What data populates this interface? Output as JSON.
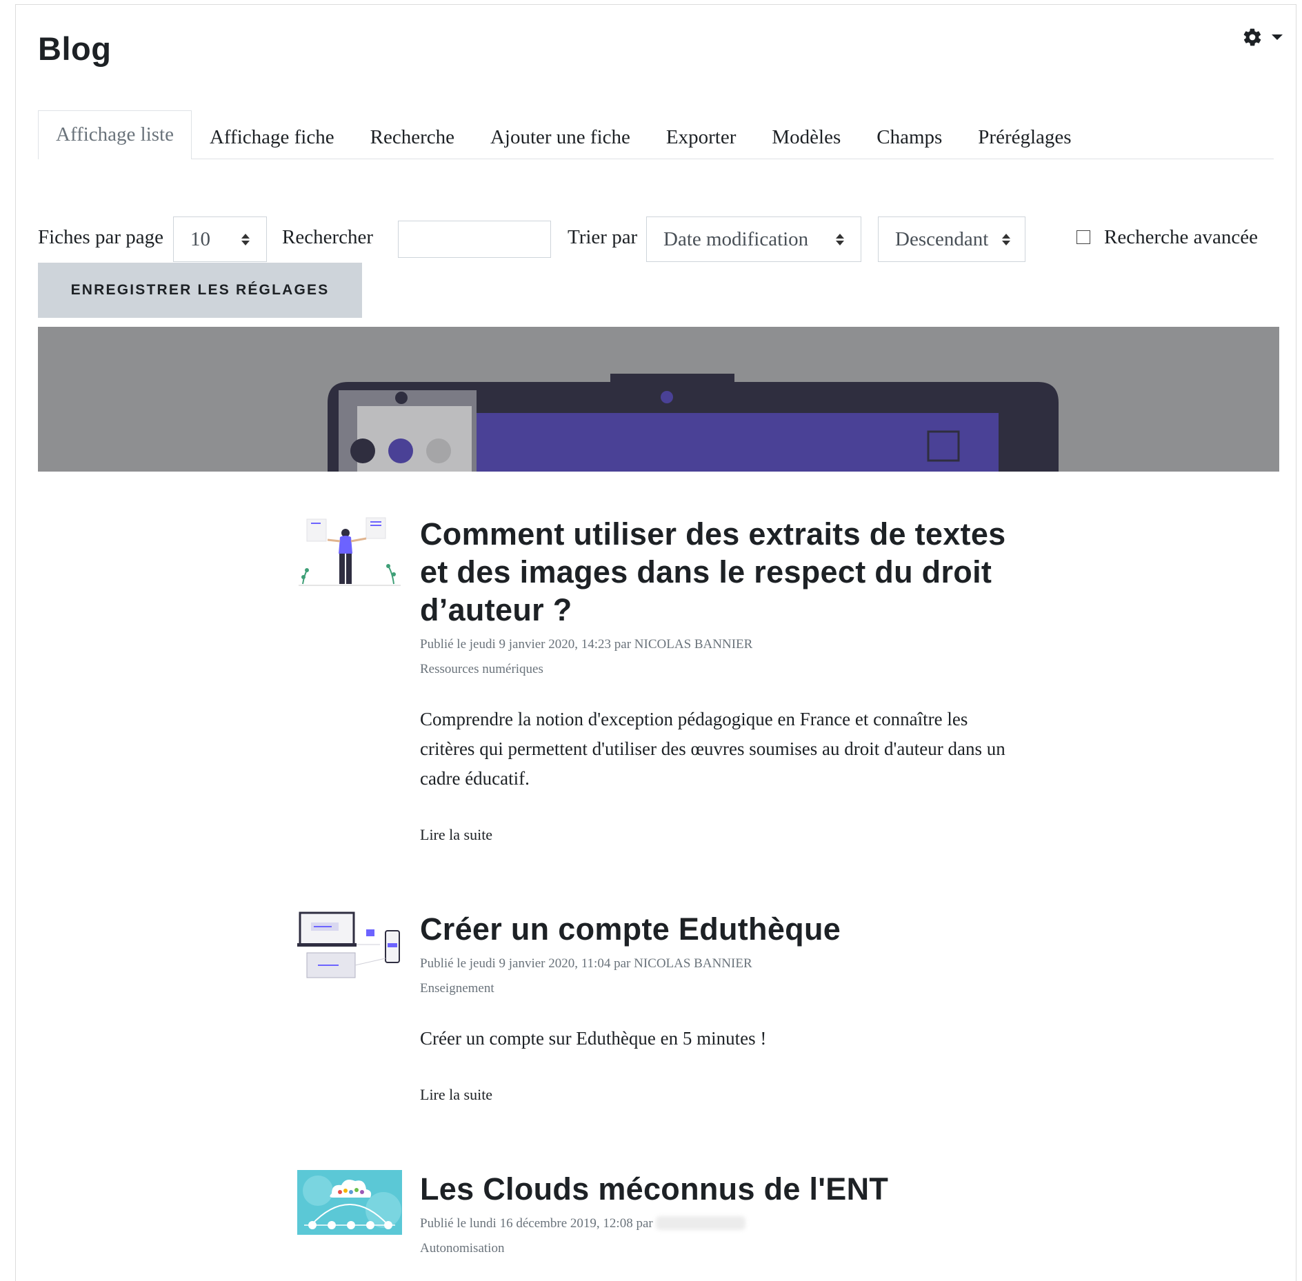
{
  "header": {
    "title": "Blog",
    "settings_icon": "gear-icon",
    "dropdown_icon": "caret-down-icon"
  },
  "tabs": [
    {
      "label": "Affichage liste",
      "active": true
    },
    {
      "label": "Affichage fiche",
      "active": false
    },
    {
      "label": "Recherche",
      "active": false
    },
    {
      "label": "Ajouter une fiche",
      "active": false
    },
    {
      "label": "Exporter",
      "active": false
    },
    {
      "label": "Modèles",
      "active": false
    },
    {
      "label": "Champs",
      "active": false
    },
    {
      "label": "Préréglages",
      "active": false
    }
  ],
  "controls": {
    "per_page_label": "Fiches par page",
    "per_page_value": "10",
    "search_label": "Rechercher",
    "search_value": "",
    "sort_label": "Trier par",
    "sort_value": "Date modification",
    "order_value": "Descendant",
    "advanced_search_label": "Recherche avancée",
    "advanced_search_checked": false,
    "save_button": "ENREGISTRER LES RÉGLAGES"
  },
  "posts": [
    {
      "title": "Comment utiliser des extraits de textes et des images dans le respect du droit d’auteur ?",
      "meta": "Publié le jeudi 9 janvier 2020, 14:23 par NICOLAS BANNIER",
      "category": "Ressources numériques",
      "excerpt": "Comprendre la notion d'exception pédagogique en France et connaître les critères qui permettent d'utiliser des œuvres soumises au droit d'auteur dans un cadre éducatif.",
      "read_more": "Lire la suite",
      "thumbnail": "person-holding-documents-illustration"
    },
    {
      "title": "Créer un compte Eduthèque",
      "meta": "Publié le jeudi 9 janvier 2020, 11:04 par NICOLAS BANNIER",
      "category": "Enseignement",
      "excerpt": "Créer un compte sur Eduthèque en 5 minutes !",
      "read_more": "Lire la suite",
      "thumbnail": "laptop-phone-account-illustration"
    },
    {
      "title": "Les Clouds méconnus de l'ENT",
      "meta": "Publié le lundi 16 décembre 2019, 12:08 par",
      "category": "Autonomisation",
      "thumbnail": "cloud-gears-illustration"
    }
  ],
  "colors": {
    "text": "#1d2125",
    "muted": "#6a737b",
    "accent_purple": "#4a4196",
    "save_button_bg": "#ced4da",
    "banner_bg": "#8e8f91"
  }
}
